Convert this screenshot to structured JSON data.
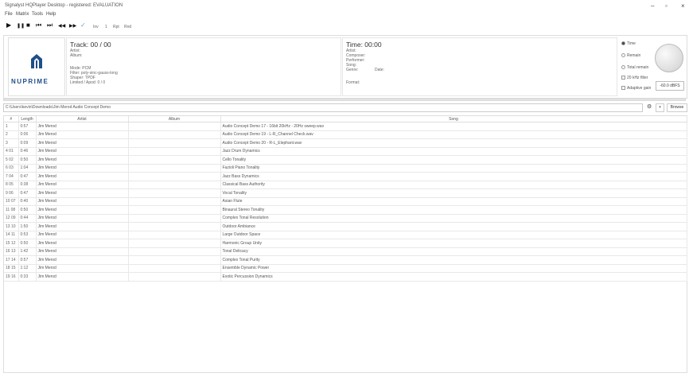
{
  "window": {
    "title": "Signalyst HQPlayer Desktop - registered: EVALUATION",
    "min": "–",
    "max": "▫",
    "close": "×"
  },
  "menu": [
    "File",
    "Matrix",
    "Tools",
    "Help"
  ],
  "toolbar": {
    "play": "▶",
    "pause": "❚❚",
    "stop": "■",
    "prev": "⏮",
    "next": "⏭",
    "rewind": "◀◀",
    "forward": "▶▶",
    "check": "✓",
    "inv": "Inv",
    "one": "1",
    "rpt": "Rpt",
    "rnd": "Rnd"
  },
  "logo": {
    "text": "NUPRIME"
  },
  "track": {
    "title": "Track: 00 / 00",
    "artist": "Artist:",
    "album": "Album:",
    "mode": "Mode: PCM",
    "filter": "Filter: poly-sinc-gauss-long",
    "shaper": "Shaper: TPDF",
    "limited": "Limited / Apod: 0 / 0"
  },
  "time": {
    "title": "Time: 00:00",
    "artist": "Artist:",
    "composer": "Composer:",
    "performer": "Performer:",
    "song": "Song:",
    "genre": "Genre:",
    "date": "Date:",
    "format": "Format:"
  },
  "options": {
    "time": "Time",
    "remain": "Remain",
    "total_remain": "Total remain",
    "filter20k": "20 kHz filter",
    "adaptive_gain": "Adaptive gain",
    "gain_value": "-60.0 dBFS"
  },
  "path": {
    "value": "C:\\Users\\kevin\\Downloads\\Jim Merod Audio Concept Demo",
    "browse": "Browse",
    "gear": "⚙",
    "drop": "▾"
  },
  "columns": {
    "num": "#",
    "length": "Length",
    "artist": "Artist",
    "album": "Album",
    "song": "Song"
  },
  "rows": [
    {
      "num": "1",
      "len": "0:57",
      "artist": "Jim Merod",
      "album": "",
      "song": "Audio Concept Demo 17 - 16bit 20kHz - 20Hz sweep.wav"
    },
    {
      "num": "2",
      "len": "0:06",
      "artist": "Jim Merod",
      "album": "",
      "song": "Audio Concept Demo 19 - L-R_Channel Check.wav"
    },
    {
      "num": "3",
      "len": "0:09",
      "artist": "Jim Merod",
      "album": "",
      "song": "Audio Concept Demo 20 - R-L_Elephant.wav"
    },
    {
      "num": "4 01",
      "len": "0:46",
      "artist": "Jim Merod",
      "album": "",
      "song": "Jazz Drum Dynamics"
    },
    {
      "num": "5 02",
      "len": "0:50",
      "artist": "Jim Merod",
      "album": "",
      "song": "Cello Tonality"
    },
    {
      "num": "6 03",
      "len": "1:04",
      "artist": "Jim Merod",
      "album": "",
      "song": "Fazioli Piano Tonality"
    },
    {
      "num": "7 04",
      "len": "0:47",
      "artist": "Jim Merod",
      "album": "",
      "song": "Jazz Bass Dynamics"
    },
    {
      "num": "8 05",
      "len": "0:38",
      "artist": "Jim Merod",
      "album": "",
      "song": "Classical Bass Authority"
    },
    {
      "num": "9 06",
      "len": "0:47",
      "artist": "Jim Merod",
      "album": "",
      "song": "Vocal Tonality"
    },
    {
      "num": "10 07",
      "len": "0:40",
      "artist": "Jim Merod",
      "album": "",
      "song": "Asian Flute"
    },
    {
      "num": "11 08",
      "len": "0:50",
      "artist": "Jim Merod",
      "album": "",
      "song": "Binaural Stereo Tonality"
    },
    {
      "num": "12 09",
      "len": "0:44",
      "artist": "Jim Merod",
      "album": "",
      "song": "Complex Tonal Resolution"
    },
    {
      "num": "13 10",
      "len": "1:50",
      "artist": "Jim Merod",
      "album": "",
      "song": "Outdoor Ambiance"
    },
    {
      "num": "14 11",
      "len": "0:53",
      "artist": "Jim Merod",
      "album": "",
      "song": "Large Outdoor Space"
    },
    {
      "num": "15 12",
      "len": "0:50",
      "artist": "Jim Merod",
      "album": "",
      "song": "Harmonic Group Unity"
    },
    {
      "num": "16 13",
      "len": "1:42",
      "artist": "Jim Merod",
      "album": "",
      "song": "Tonal Delicacy"
    },
    {
      "num": "17 14",
      "len": "0:57",
      "artist": "Jim Merod",
      "album": "",
      "song": "Complex Tonal Purity"
    },
    {
      "num": "18 15",
      "len": "1:12",
      "artist": "Jim Merod",
      "album": "",
      "song": "Ensemble Dynamic Power"
    },
    {
      "num": "19 16",
      "len": "0:33",
      "artist": "Jim Merod",
      "album": "",
      "song": "Exotic Percussion Dynamics"
    }
  ]
}
